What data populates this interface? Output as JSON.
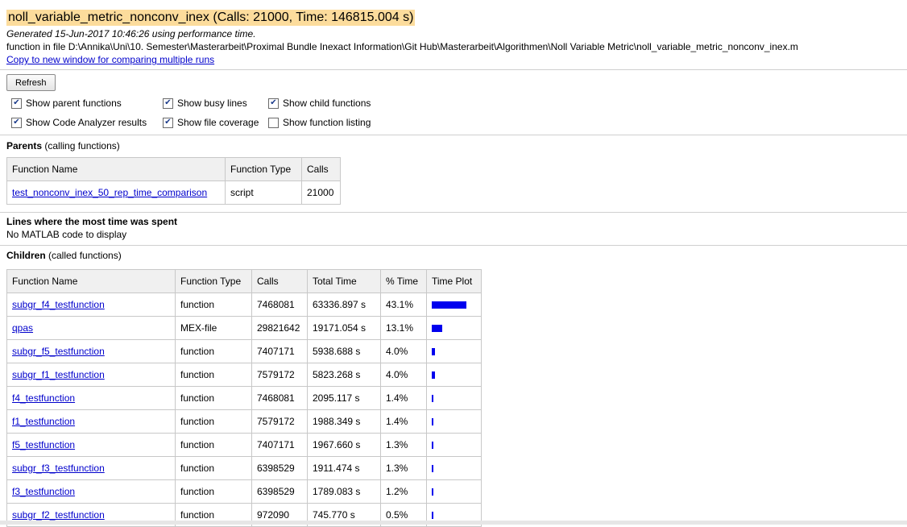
{
  "header": {
    "title": "noll_variable_metric_nonconv_inex (Calls: 21000, Time: 146815.004 s)",
    "generated": "Generated 15-Jun-2017 10:46:26 using performance time.",
    "file_line": "function in file D:\\Annika\\Uni\\10. Semester\\Masterarbeit\\Proximal Bundle Inexact Information\\Git Hub\\Masterarbeit\\Algorithmen\\Noll Variable Metric\\noll_variable_metric_nonconv_inex.m",
    "copy_link": "Copy to new window for comparing multiple runs"
  },
  "controls": {
    "refresh_label": "Refresh",
    "options": [
      {
        "label": "Show parent functions",
        "checked": true
      },
      {
        "label": "Show busy lines",
        "checked": true
      },
      {
        "label": "Show child functions",
        "checked": true
      },
      {
        "label": "Show Code Analyzer results",
        "checked": true
      },
      {
        "label": "Show file coverage",
        "checked": true
      },
      {
        "label": "Show function listing",
        "checked": false
      }
    ]
  },
  "parents": {
    "title": "Parents",
    "subtitle": " (calling functions)",
    "headers": [
      "Function Name",
      "Function Type",
      "Calls"
    ],
    "rows": [
      {
        "name": "test_nonconv_inex_50_rep_time_comparison",
        "type": "script",
        "calls": "21000"
      }
    ]
  },
  "busy_lines": {
    "title": "Lines where the most time was spent",
    "message": "No MATLAB code to display"
  },
  "children": {
    "title": "Children",
    "subtitle": " (called functions)",
    "headers": [
      "Function Name",
      "Function Type",
      "Calls",
      "Total Time",
      "% Time",
      "Time Plot"
    ],
    "rows": [
      {
        "name": "subgr_f4_testfunction",
        "type": "function",
        "calls": "7468081",
        "total": "63336.897 s",
        "pct": "43.1%",
        "plot": 0.431
      },
      {
        "name": "qpas",
        "type": "MEX-file",
        "calls": "29821642",
        "total": "19171.054 s",
        "pct": "13.1%",
        "plot": 0.131
      },
      {
        "name": "subgr_f5_testfunction",
        "type": "function",
        "calls": "7407171",
        "total": "5938.688 s",
        "pct": "4.0%",
        "plot": 0.04
      },
      {
        "name": "subgr_f1_testfunction",
        "type": "function",
        "calls": "7579172",
        "total": "5823.268 s",
        "pct": "4.0%",
        "plot": 0.04
      },
      {
        "name": "f4_testfunction",
        "type": "function",
        "calls": "7468081",
        "total": "2095.117 s",
        "pct": "1.4%",
        "plot": 0.014
      },
      {
        "name": "f1_testfunction",
        "type": "function",
        "calls": "7579172",
        "total": "1988.349 s",
        "pct": "1.4%",
        "plot": 0.014
      },
      {
        "name": "f5_testfunction",
        "type": "function",
        "calls": "7407171",
        "total": "1967.660 s",
        "pct": "1.3%",
        "plot": 0.013
      },
      {
        "name": "subgr_f3_testfunction",
        "type": "function",
        "calls": "6398529",
        "total": "1911.474 s",
        "pct": "1.3%",
        "plot": 0.013
      },
      {
        "name": "f3_testfunction",
        "type": "function",
        "calls": "6398529",
        "total": "1789.083 s",
        "pct": "1.2%",
        "plot": 0.012
      },
      {
        "name": "subgr_f2_testfunction",
        "type": "function",
        "calls": "972090",
        "total": "745.770 s",
        "pct": "0.5%",
        "plot": 0.005
      }
    ]
  }
}
